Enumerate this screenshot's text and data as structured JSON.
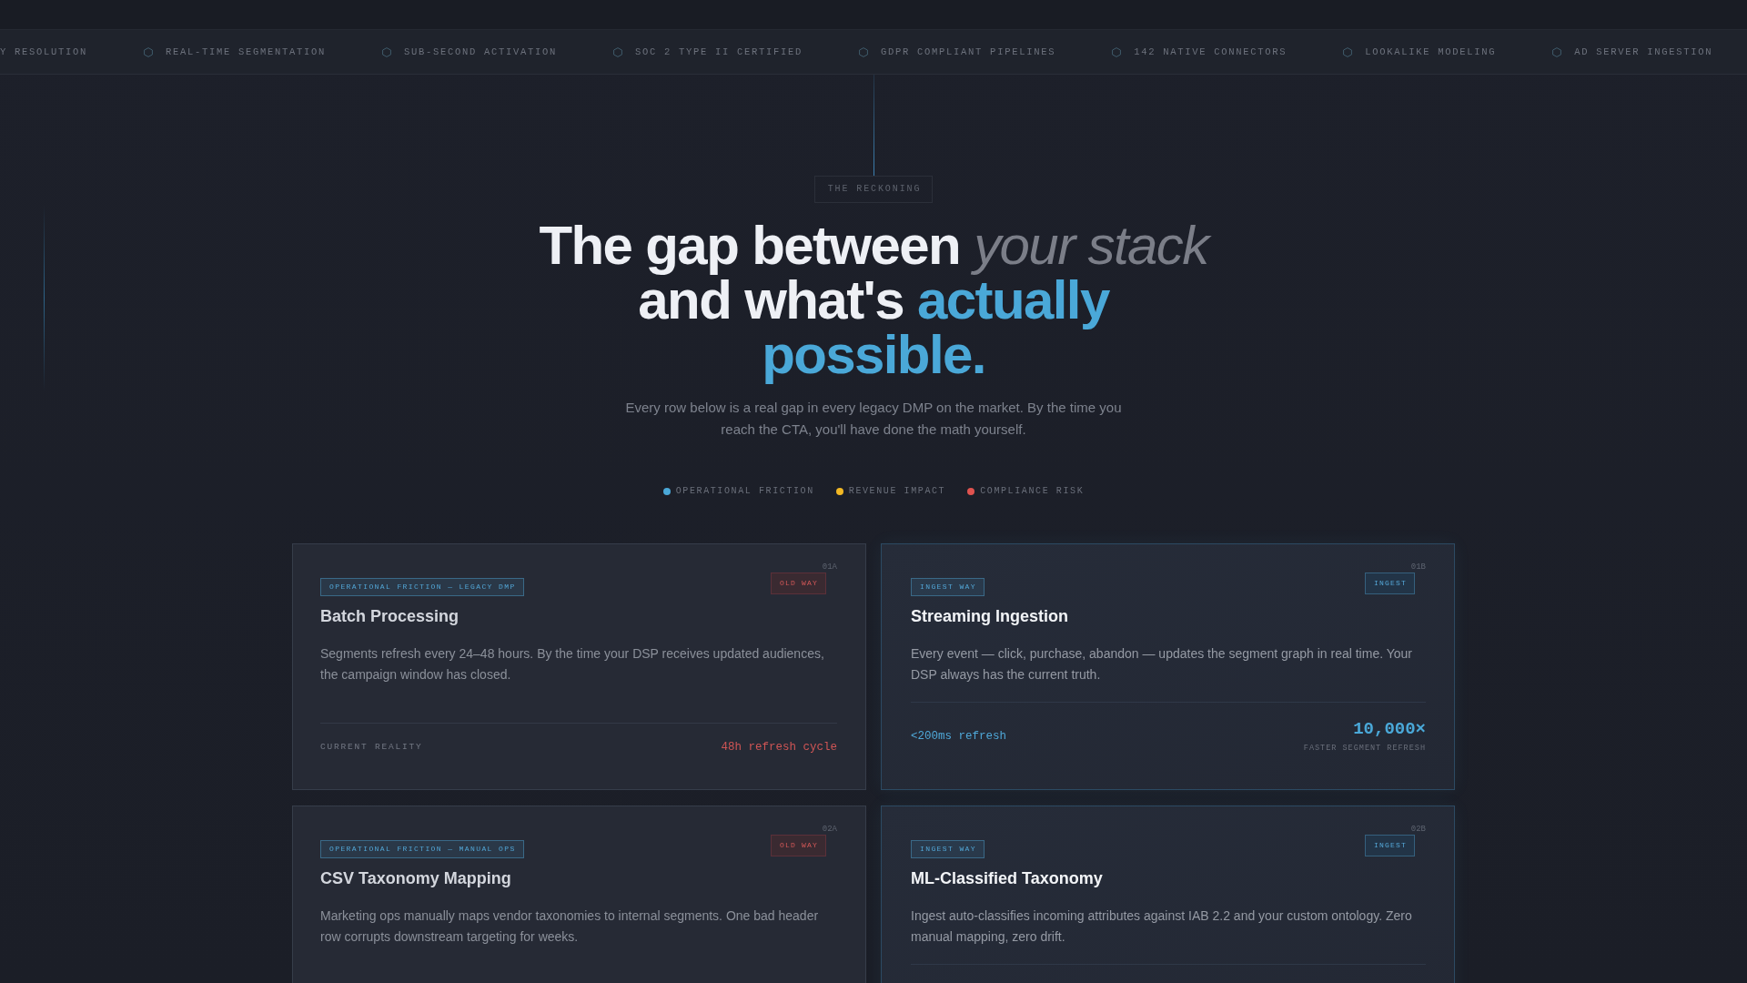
{
  "ticker": [
    "Y RESOLUTION",
    "REAL-TIME SEGMENTATION",
    "SUB-SECOND ACTIVATION",
    "SOC 2 TYPE II CERTIFIED",
    "GDPR COMPLIANT PIPELINES",
    "142 NATIVE CONNECTORS",
    "LOOKALIKE MODELING",
    "AD SERVER INGESTION"
  ],
  "section": {
    "eyebrow": "THE RECKONING",
    "headline": [
      {
        "kind": "plain",
        "text": "The gap between "
      },
      {
        "kind": "muted",
        "text": "your stack"
      },
      {
        "kind": "plain",
        "text": " and what's "
      },
      {
        "kind": "accent",
        "text": "actually possible."
      }
    ],
    "intro": "Every row below is a real gap in every legacy DMP on the market. By the time you reach the CTA, you'll have done the math yourself.",
    "legend": [
      {
        "label": "OPERATIONAL FRICTION",
        "color": "#4aa8d8"
      },
      {
        "label": "REVENUE IMPACT",
        "color": "#f2b824"
      },
      {
        "label": "COMPLIANCE RISK",
        "color": "#e0534f"
      }
    ]
  },
  "cards": [
    {
      "kind": "old",
      "index": "01A",
      "badge": "OLD WAY",
      "category": "OPERATIONAL FRICTION — LEGACY DMP",
      "title": "Batch Processing",
      "description": "Segments refresh every 24–48 hours. By the time your DSP receives updated audiences, the campaign window has closed.",
      "footer": {
        "kind": "reality",
        "label": "CURRENT REALITY",
        "value": "48h refresh cycle"
      }
    },
    {
      "kind": "ingest",
      "index": "01B",
      "badge": "INGEST",
      "category": "INGEST WAY",
      "title": "Streaming Ingestion",
      "description": "Every event — click, purchase, abandon — updates the segment graph in real time. Your DSP always has the current truth.",
      "footer": {
        "kind": "metric",
        "value": "<200ms refresh",
        "metric": "10,000×",
        "caption": "FASTER SEGMENT REFRESH"
      }
    },
    {
      "kind": "old",
      "index": "02A",
      "badge": "OLD WAY",
      "category": "OPERATIONAL FRICTION — MANUAL OPS",
      "title": "CSV Taxonomy Mapping",
      "description": "Marketing ops manually maps vendor taxonomies to internal segments. One bad header row corrupts downstream targeting for weeks."
    },
    {
      "kind": "ingest",
      "index": "02B",
      "badge": "INGEST",
      "category": "INGEST WAY",
      "title": "ML-Classified Taxonomy",
      "description": "Ingest auto-classifies incoming attributes against IAB 2.2 and your custom ontology. Zero manual mapping, zero drift."
    }
  ]
}
